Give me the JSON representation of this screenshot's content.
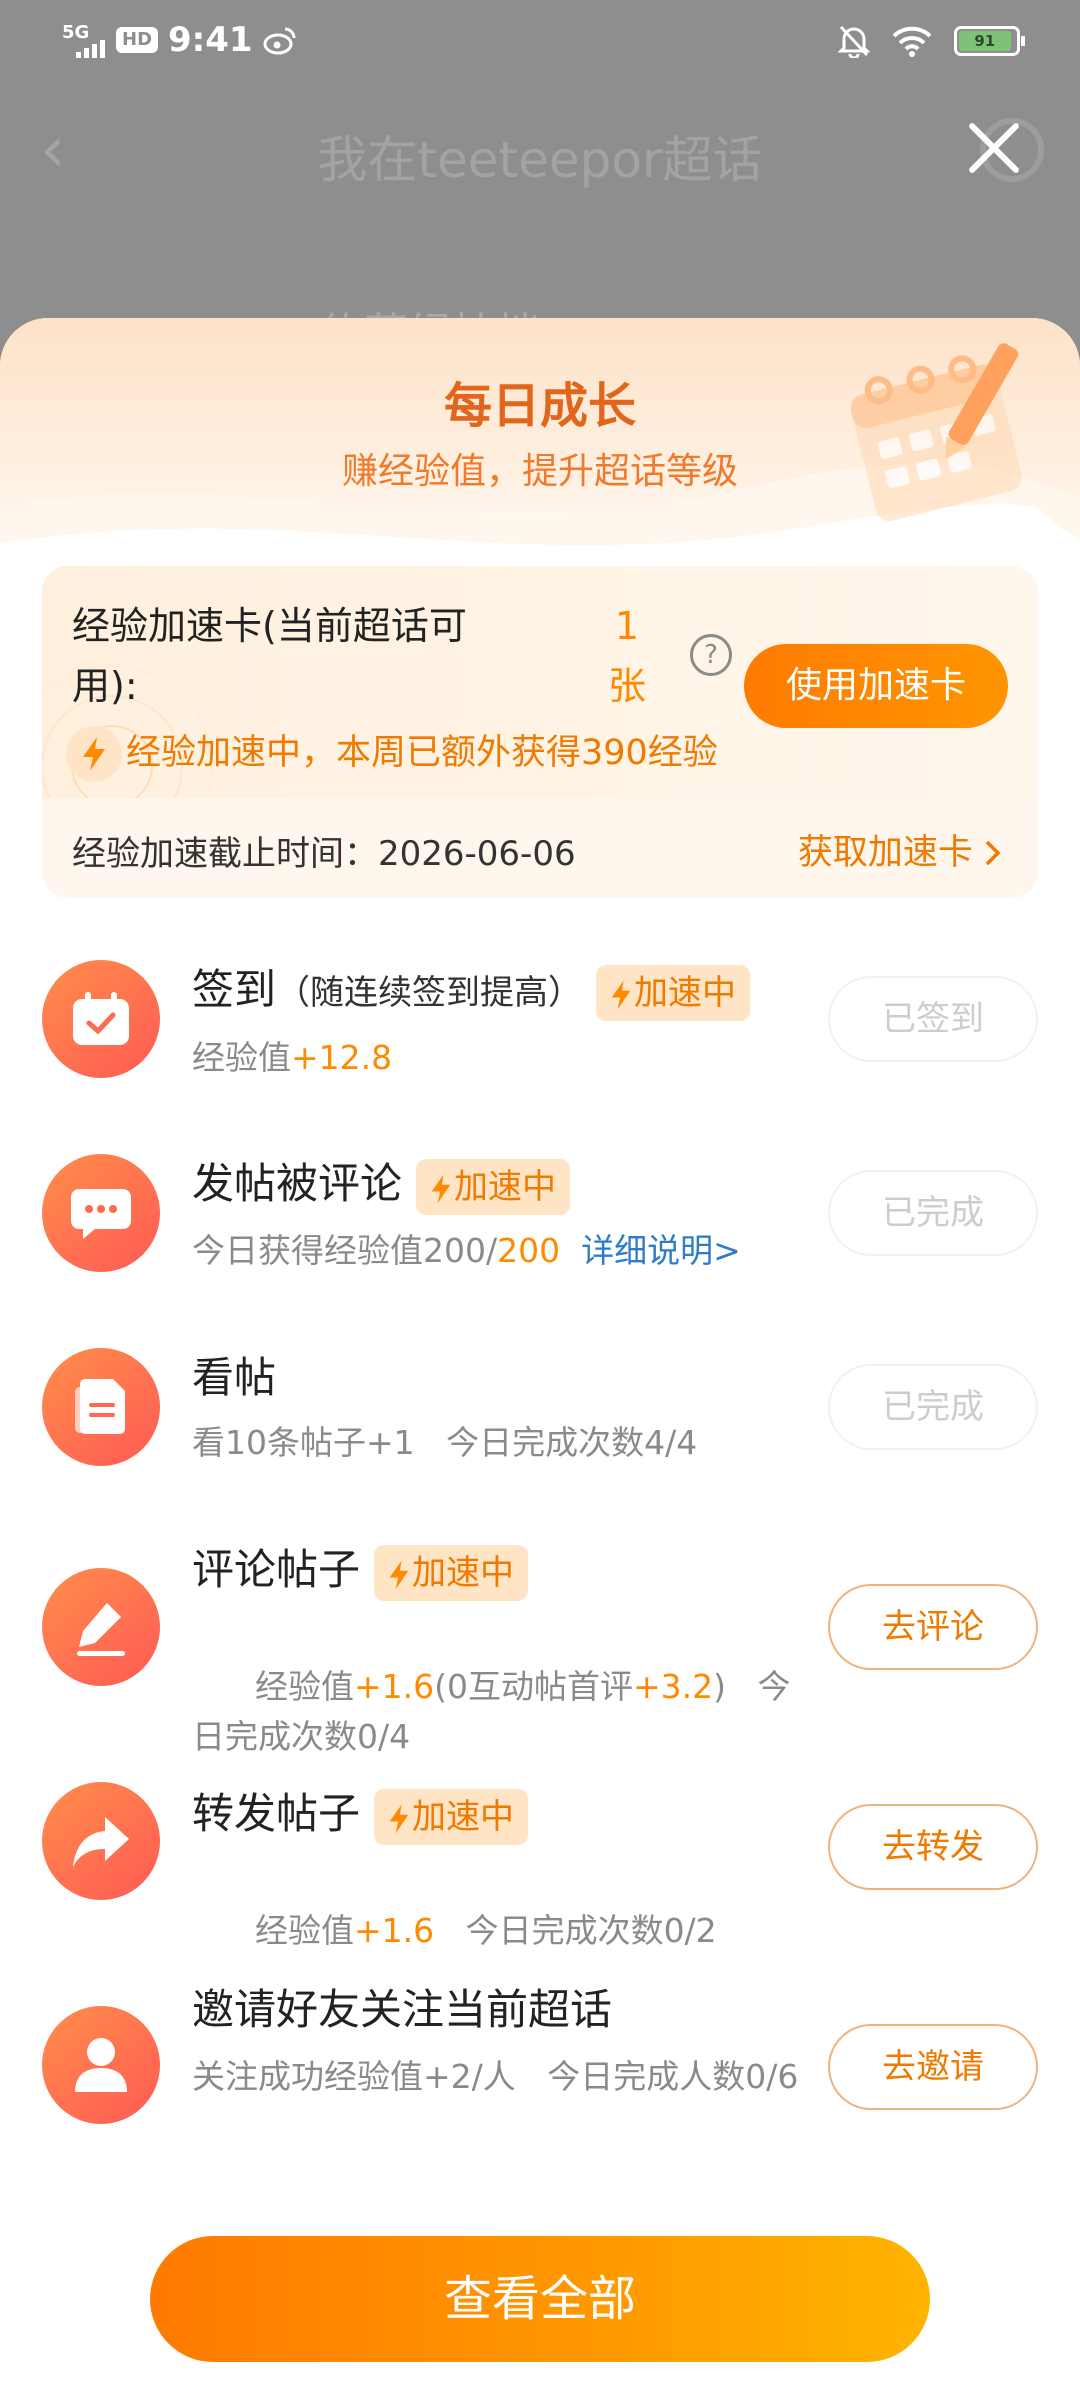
{
  "status_bar": {
    "network": "5G",
    "hd": "HD",
    "time": "9:41",
    "battery": "91"
  },
  "background": {
    "title": "我在teeteepor超话",
    "peek_text": "约草绿挂挡"
  },
  "sheet": {
    "title": "每日成长",
    "subtitle": "赚经验值，提升超话等级"
  },
  "speed_card": {
    "label": "经验加速卡(当前超话可用):",
    "count": "1",
    "unit": "张",
    "help": "?",
    "use_button": "使用加速卡",
    "message": "经验加速中，本周已额外获得390经验",
    "deadline_label": "经验加速截止时间：",
    "deadline_value": "2026-06-06",
    "get_link": "获取加速卡"
  },
  "tasks": [
    {
      "title": "签到",
      "note": "（随连续签到提高）",
      "badge": "加速中",
      "desc_prefix": "经验值",
      "desc_value": "+12.8",
      "button": "已签到"
    },
    {
      "title": "发帖被评论",
      "badge": "加速中",
      "desc_prefix": "今日获得经验值200/",
      "desc_value": "200",
      "link": "详细说明>",
      "button": "已完成"
    },
    {
      "title": "看帖",
      "desc": "看10条帖子+1   今日完成次数4/4",
      "button": "已完成"
    },
    {
      "title": "评论帖子",
      "badge": "加速中",
      "desc_a": "经验值",
      "desc_b": "+1.6",
      "desc_c": "(0互动帖首评",
      "desc_d": "+3.2",
      "desc_e": ")   今日完成次数0/4",
      "button": "去评论"
    },
    {
      "title": "转发帖子",
      "badge": "加速中",
      "desc_prefix": "经验值",
      "desc_value": "+1.6",
      "desc_suffix": "   今日完成次数0/2",
      "button": "去转发"
    },
    {
      "title": "邀请好友关注当前超话",
      "desc": "关注成功经验值+2/人   今日完成人数0/6",
      "button": "去邀请"
    }
  ],
  "view_all": "查看全部",
  "colors": {
    "accent": "#ff8a00",
    "title": "#e2651c",
    "link": "#2f7dc7"
  }
}
